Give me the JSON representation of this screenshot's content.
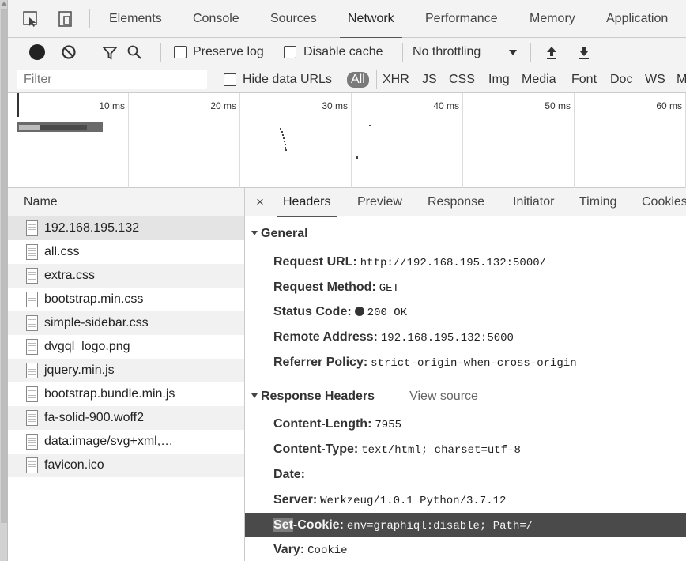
{
  "main_tabs": [
    {
      "label": "Elements"
    },
    {
      "label": "Console"
    },
    {
      "label": "Sources"
    },
    {
      "label": "Network",
      "active": true
    },
    {
      "label": "Performance"
    },
    {
      "label": "Memory"
    },
    {
      "label": "Application"
    }
  ],
  "toolbar": {
    "preserve_log": "Preserve log",
    "disable_cache": "Disable cache",
    "throttling": "No throttling"
  },
  "filter": {
    "placeholder": "Filter",
    "hide_data_urls": "Hide data URLs",
    "types": [
      "All",
      "XHR",
      "JS",
      "CSS",
      "Img",
      "Media",
      "Font",
      "Doc",
      "WS",
      "M"
    ],
    "active_type": "All"
  },
  "timeline": {
    "labels": [
      "10 ms",
      "20 ms",
      "30 ms",
      "40 ms",
      "50 ms",
      "60 ms"
    ]
  },
  "requests": {
    "header": "Name",
    "items": [
      "192.168.195.132",
      "all.css",
      "extra.css",
      "bootstrap.min.css",
      "simple-sidebar.css",
      "dvgql_logo.png",
      "jquery.min.js",
      "bootstrap.bundle.min.js",
      "fa-solid-900.woff2",
      "data:image/svg+xml,…",
      "favicon.ico"
    ],
    "selected_index": 0
  },
  "detail": {
    "close": "×",
    "tabs": [
      "Headers",
      "Preview",
      "Response",
      "Initiator",
      "Timing",
      "Cookies"
    ],
    "active_tab": "Headers",
    "general": {
      "title": "General",
      "rows": [
        {
          "key": "Request URL:",
          "value": "http://192.168.195.132:5000/"
        },
        {
          "key": "Request Method:",
          "value": "GET"
        },
        {
          "key": "Status Code:",
          "value": "200 OK"
        },
        {
          "key": "Remote Address:",
          "value": "192.168.195.132:5000"
        },
        {
          "key": "Referrer Policy:",
          "value": "strict-origin-when-cross-origin"
        }
      ]
    },
    "response_headers": {
      "title": "Response Headers",
      "view_source": "View source",
      "rows": [
        {
          "key": "Content-Length:",
          "value": "7955"
        },
        {
          "key": "Content-Type:",
          "value": "text/html; charset=utf-8"
        },
        {
          "key": "Date:",
          "value": ""
        },
        {
          "key": "Server:",
          "value": "Werkzeug/1.0.1 Python/3.7.12"
        },
        {
          "key_hl": "Set",
          "key_rest": "-Cookie:",
          "value": "env=graphiql:disable; Path=/"
        },
        {
          "key": "Vary:",
          "value": "Cookie"
        }
      ]
    }
  }
}
